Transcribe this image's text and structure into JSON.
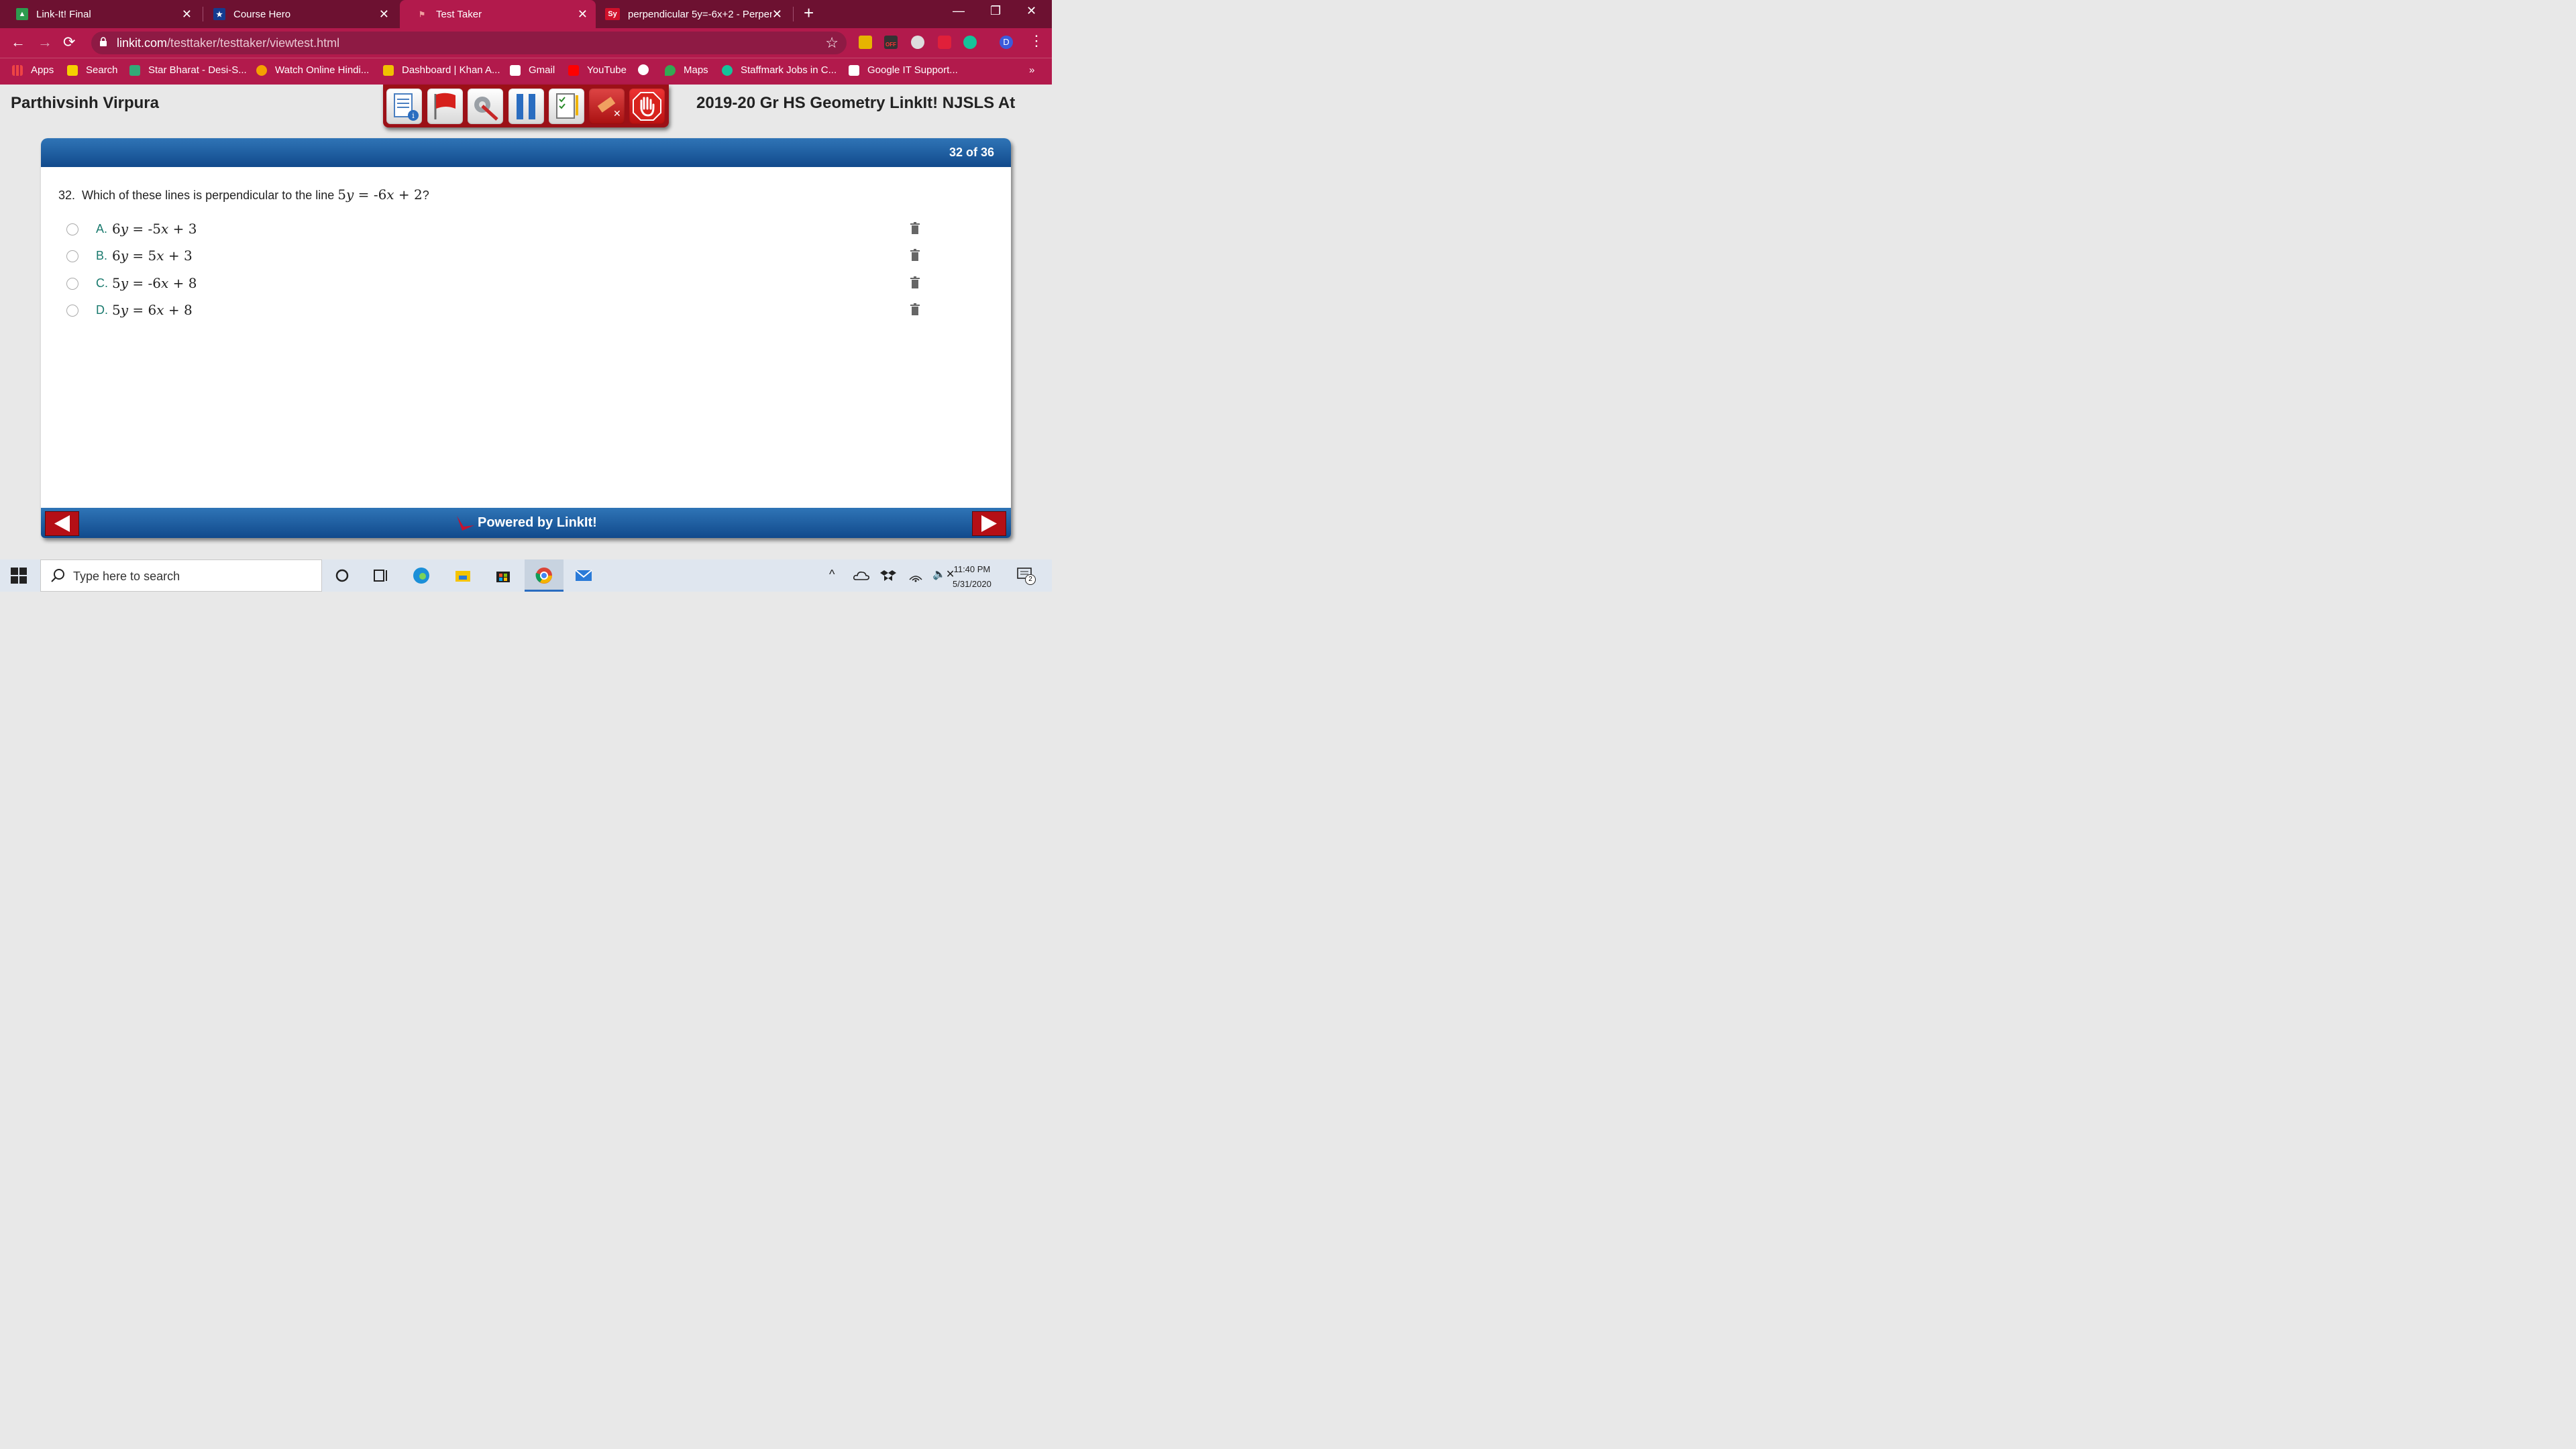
{
  "browser": {
    "tabs": [
      {
        "title": "Link-It! Final",
        "active": false
      },
      {
        "title": "Course Hero",
        "active": false
      },
      {
        "title": "Test Taker",
        "active": true
      },
      {
        "title": "perpendicular 5y=-6x+2 - Perpen",
        "active": false
      }
    ],
    "fav_sy": "Sy",
    "url_host": "linkit.com",
    "url_path": "/testtaker/testtaker/viewtest.html",
    "ext_badge": "OFF",
    "profile_initial": "D",
    "bookmarks": [
      "Apps",
      "Search",
      "Star Bharat - Desi-S...",
      "Watch Online Hindi...",
      "Dashboard | Khan A...",
      "Gmail",
      "YouTube",
      "Maps",
      "Staffmark Jobs in C...",
      "Google IT Support..."
    ],
    "bookmarks_more": "»"
  },
  "app": {
    "student_name": "Parthivsinh Virpura",
    "test_name": "2019-20 Gr HS Geometry LinkIt! NJSLS At",
    "counter": "32 of 36",
    "question": {
      "number": "32.",
      "text": "Which of these lines is perpendicular to the line",
      "eq": {
        "c1": "5",
        "v1": "y",
        "eqs": " = ",
        "c2": "-6",
        "v2": "x",
        "rest": " + 2"
      },
      "end": "?"
    },
    "choices": [
      {
        "letter": "A.",
        "c1": "6",
        "v1": "y",
        "eqs": " = ",
        "c2": "-5",
        "v2": "x",
        "rest": " + 3"
      },
      {
        "letter": "B.",
        "c1": "6",
        "v1": "y",
        "eqs": " = ",
        "c2": "5",
        "v2": "x",
        "rest": " + 3"
      },
      {
        "letter": "C.",
        "c1": "5",
        "v1": "y",
        "eqs": " = ",
        "c2": "-6",
        "v2": "x",
        "rest": " + 8"
      },
      {
        "letter": "D.",
        "c1": "5",
        "v1": "y",
        "eqs": " = ",
        "c2": "6",
        "v2": "x",
        "rest": " + 8"
      }
    ],
    "footer": "Powered by LinkIt!"
  },
  "taskbar": {
    "search_placeholder": "Type here to search",
    "time": "11:40 PM",
    "date": "5/31/2020",
    "notif_count": "2"
  },
  "colors": {
    "tab_bar": "#6d1131",
    "toolbar": "#b21a4c",
    "panel_blue": "#1f5fa3",
    "tool_red": "#9c1017",
    "choice_letter": "#1a7a6e"
  }
}
